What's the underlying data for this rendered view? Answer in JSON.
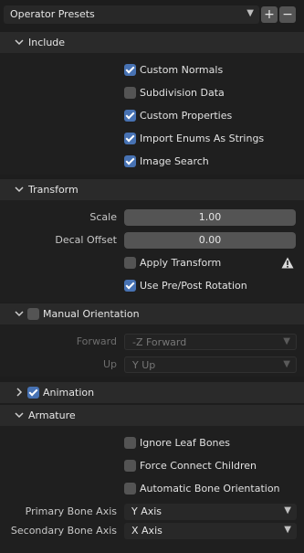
{
  "presets": {
    "label": "Operator Presets",
    "add": "+",
    "remove": "−"
  },
  "include": {
    "title": "Include",
    "items": [
      {
        "label": "Custom Normals",
        "checked": true
      },
      {
        "label": "Subdivision Data",
        "checked": false
      },
      {
        "label": "Custom Properties",
        "checked": true
      },
      {
        "label": "Import Enums As Strings",
        "checked": true
      },
      {
        "label": "Image Search",
        "checked": true
      }
    ]
  },
  "transform": {
    "title": "Transform",
    "scale_label": "Scale",
    "scale_value": "1.00",
    "decal_label": "Decal Offset",
    "decal_value": "0.00",
    "apply_label": "Apply Transform",
    "prepost_label": "Use Pre/Post Rotation"
  },
  "manual_orientation": {
    "title": "Manual Orientation",
    "forward_label": "Forward",
    "forward_value": "-Z Forward",
    "up_label": "Up",
    "up_value": "Y Up"
  },
  "animation": {
    "title": "Animation"
  },
  "armature": {
    "title": "Armature",
    "ignore_leaf": "Ignore Leaf Bones",
    "force_connect": "Force Connect Children",
    "auto_orient": "Automatic Bone Orientation",
    "primary_label": "Primary Bone Axis",
    "primary_value": "Y Axis",
    "secondary_label": "Secondary Bone Axis",
    "secondary_value": "X Axis"
  },
  "colors": {
    "accent": "#4772b3",
    "panel": "#2a2a2a",
    "background": "#1d1d1d"
  }
}
